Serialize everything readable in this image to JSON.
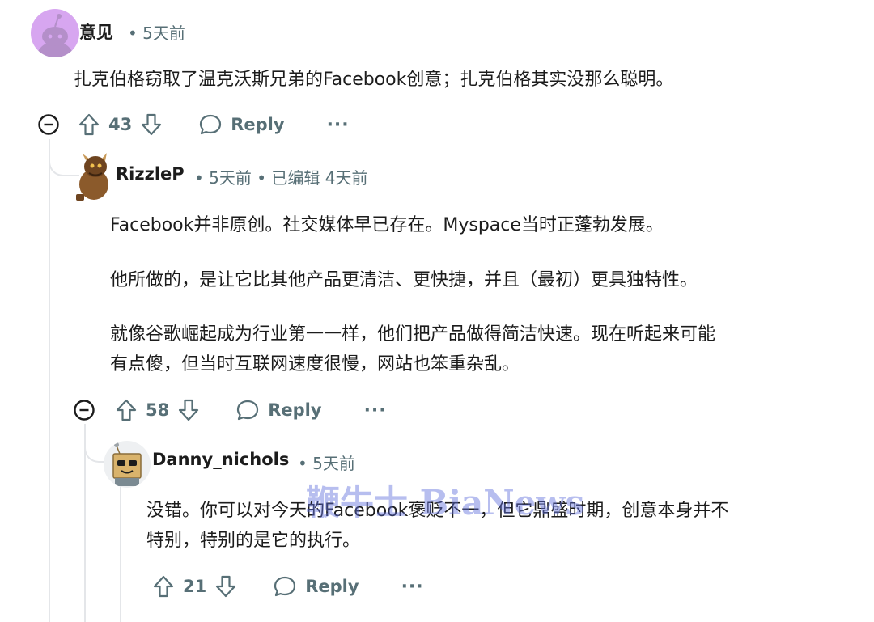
{
  "comments": [
    {
      "username": "意见",
      "meta": "• 5天前",
      "body": [
        "扎克伯格窃取了温克沃斯兄弟的Facebook创意；扎克伯格其实没那么聪明。"
      ],
      "score": "43",
      "reply_label": "Reply",
      "more_label": "···"
    },
    {
      "username": "RizzleP",
      "meta": "• 5天前 • 已编辑 4天前",
      "body": [
        "Facebook并非原创。社交媒体早已存在。Myspace当时正蓬勃发展。",
        "他所做的，是让它比其他产品更清洁、更快捷，并且（最初）更具独特性。",
        "就像谷歌崛起成为行业第一一样，他们把产品做得简洁快速。现在听起来可能",
        "有点傻，但当时互联网速度很慢，网站也笨重杂乱。"
      ],
      "score": "58",
      "reply_label": "Reply",
      "more_label": "···"
    },
    {
      "username": "Danny_nichols",
      "meta": "• 5天前",
      "body": [
        "没错。你可以对今天的Facebook褒贬不一，但它鼎盛时期，创意本身并不",
        "特别，特别的是它的执行。"
      ],
      "score": "21",
      "reply_label": "Reply",
      "more_label": "···"
    }
  ],
  "watermark": "鞭牛士 BiaNews",
  "icons": {
    "collapse": "minus-circle-icon",
    "upvote": "arrow-up-icon",
    "downvote": "arrow-down-icon",
    "reply": "speech-bubble-icon"
  },
  "colors": {
    "meta": "#576f76",
    "thread_line": "#e4e6e9",
    "avatar1_bg": "#d7a6f0"
  }
}
